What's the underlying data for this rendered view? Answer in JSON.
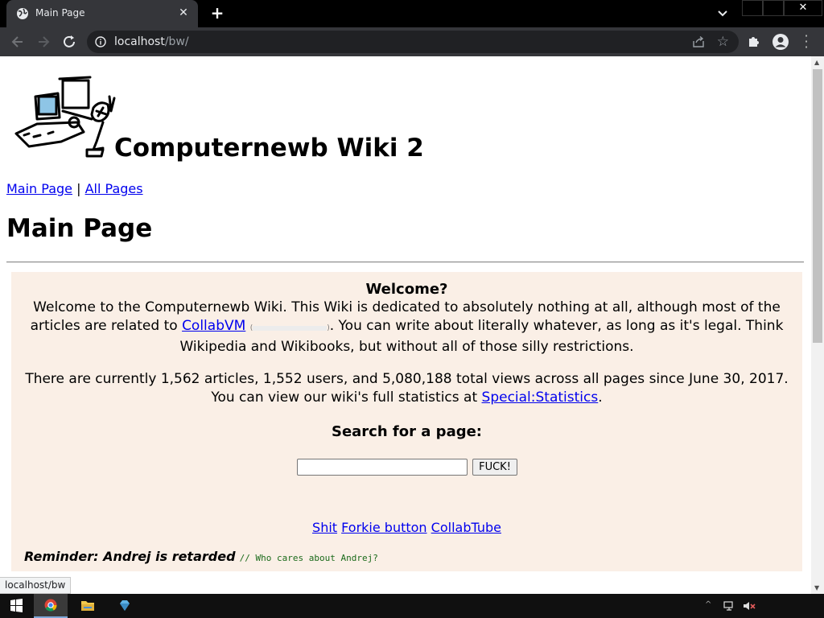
{
  "browser": {
    "tab_title": "Main Page",
    "url_host": "localhost",
    "url_path": "/bw/",
    "status_url": "localhost/bw"
  },
  "site": {
    "title": "Computernewb Wiki 2",
    "nav": {
      "main_page": "Main Page",
      "separator": "|",
      "all_pages": "All Pages"
    }
  },
  "page": {
    "heading": "Main Page",
    "welcome": {
      "title": "Welcome?",
      "intro_before_link": "Welcome to the Computernewb Wiki. This Wiki is dedicated to absolutely nothing at all, although most of the articles are related to ",
      "collabvm_link": "CollabVM",
      "cite_open": "(",
      "cite_close": ")",
      "intro_after_link": ". You can write about literally whatever, as long as it's legal. Think Wikipedia and Wikibooks, but without all of those silly restrictions.",
      "stats_line": "There are currently 1,562 articles, 1,552 users, and 5,080,188 total views across all pages since June 30, 2017.",
      "stats_line2_before": "You can view our wiki's full statistics at ",
      "statistics_link": "Special:Statistics",
      "stats_line2_after": "."
    },
    "search": {
      "title": "Search for a page:",
      "input_value": "",
      "button_label": "FUCK!"
    },
    "links": {
      "shit": "Shit",
      "forkie": "Forkie button",
      "collabtube": "CollabTube"
    },
    "reminder": {
      "text": "Reminder: Andrej is retarded",
      "comment": "// Who cares about Andrej?"
    }
  },
  "colors": {
    "link": "#0000ee",
    "welcome_bg": "#faefe6",
    "chrome_toolbar": "#35363a",
    "omnibox": "#202124"
  }
}
